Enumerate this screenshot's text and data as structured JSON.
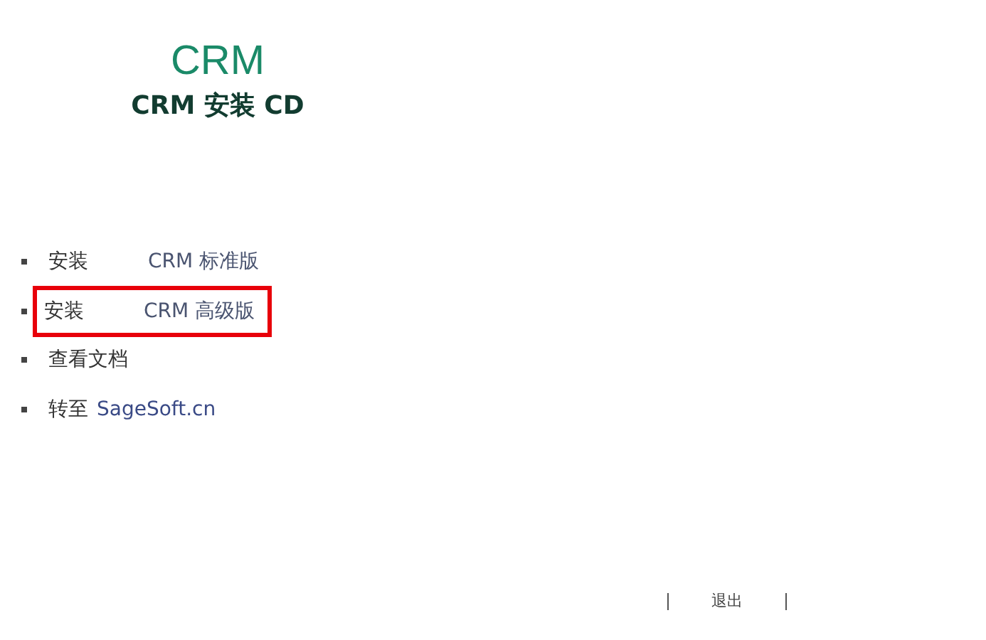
{
  "header": {
    "logo": "CRM",
    "title": "CRM 安装 CD"
  },
  "menu": [
    {
      "label": "安装",
      "detail": "CRM 标准版",
      "highlighted": false
    },
    {
      "label": "安装",
      "detail": "CRM 高级版",
      "highlighted": true
    },
    {
      "label": "查看文档",
      "highlighted": false
    },
    {
      "label": "转至",
      "detail": "SageSoft.cn",
      "highlighted": false
    }
  ],
  "footer": {
    "exit": "退出"
  }
}
